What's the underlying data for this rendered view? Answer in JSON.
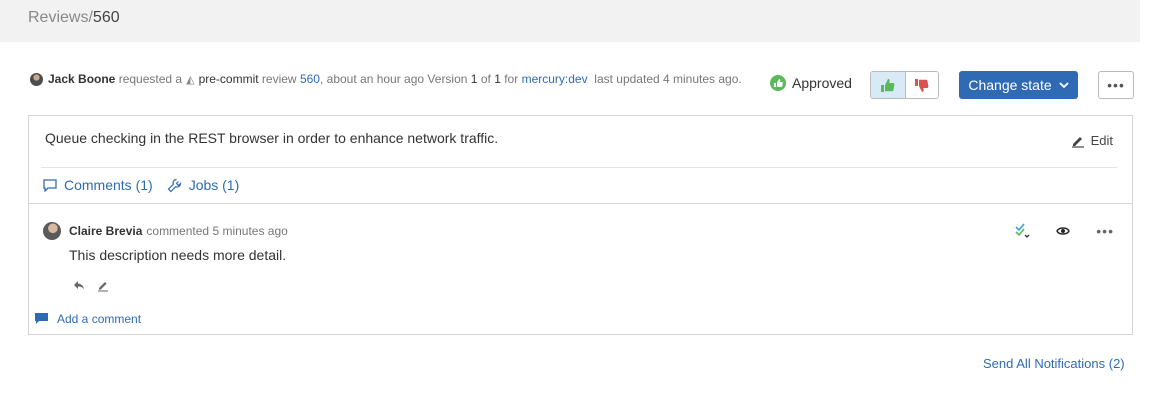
{
  "breadcrumb": {
    "section": "Reviews",
    "separator": "/",
    "id": "560"
  },
  "review_meta": {
    "author": "Jack Boone",
    "requested_text": "requested a",
    "review_type": "pre-commit",
    "review_word": "review",
    "review_id": "560",
    "time_text": ", about an hour ago",
    "version_word": "Version",
    "version_current": "1",
    "version_of": "of",
    "version_total": "1",
    "for_word": "for",
    "project": "mercury:dev",
    "updated_text": "last updated 4 minutes ago."
  },
  "state": {
    "label": "Approved",
    "color": "#5cb85c"
  },
  "vote": {
    "up_icon": "thumbs-up-icon",
    "down_icon": "thumbs-down-icon",
    "up_color": "#5cb85c",
    "down_color": "#d9534f"
  },
  "actions": {
    "change_state_label": "Change state",
    "more_label": "•••"
  },
  "description": {
    "text": "Queue checking in the REST browser in order to enhance network traffic.",
    "edit_label": "Edit"
  },
  "tabs": [
    {
      "label": "Comments (1)",
      "icon": "comment-icon"
    },
    {
      "label": "Jobs (1)",
      "icon": "wrench-icon"
    }
  ],
  "comment": {
    "author": "Claire Brevia",
    "action": "commented",
    "time": "5 minutes ago",
    "text": "This description needs more detail.",
    "more_label": "•••"
  },
  "add_comment_label": "Add a comment",
  "notifications_label": "Send All Notifications (2)",
  "colors": {
    "accent": "#2f6bb5",
    "text": "#333333",
    "muted": "#777777",
    "border": "#d6d6d6"
  }
}
